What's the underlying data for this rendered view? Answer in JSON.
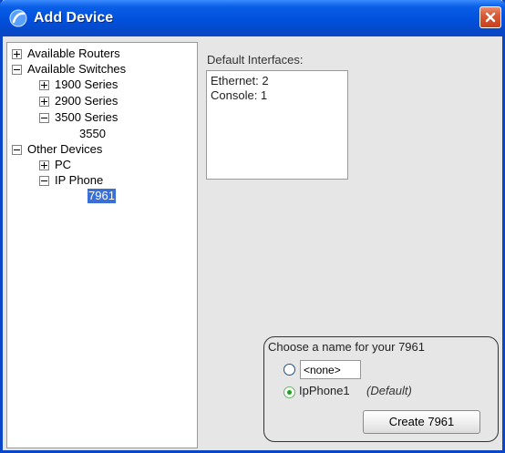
{
  "window": {
    "title": "Add Device"
  },
  "tree": {
    "available_routers": "Available Routers",
    "available_switches": "Available Switches",
    "series_1900": "1900 Series",
    "series_2900": "2900 Series",
    "series_3500": "3500 Series",
    "model_3550": "3550",
    "other_devices": "Other Devices",
    "pc": "PC",
    "ip_phone": "IP Phone",
    "model_7961": "7961"
  },
  "interfaces": {
    "label": "Default Interfaces:",
    "lines": [
      "Ethernet: 2",
      "Console: 1"
    ]
  },
  "naming": {
    "legend": "Choose a name for your 7961",
    "custom_value": "<none>",
    "default_name": "IpPhone1",
    "default_tag": "(Default)",
    "create_label": "Create 7961"
  },
  "colors": {
    "titlebar": "#0050dc",
    "selection": "#3a6fd8",
    "close_button": "#d85a36"
  },
  "icons": {
    "title": "app-swirl-icon",
    "close": "close-x-icon"
  }
}
